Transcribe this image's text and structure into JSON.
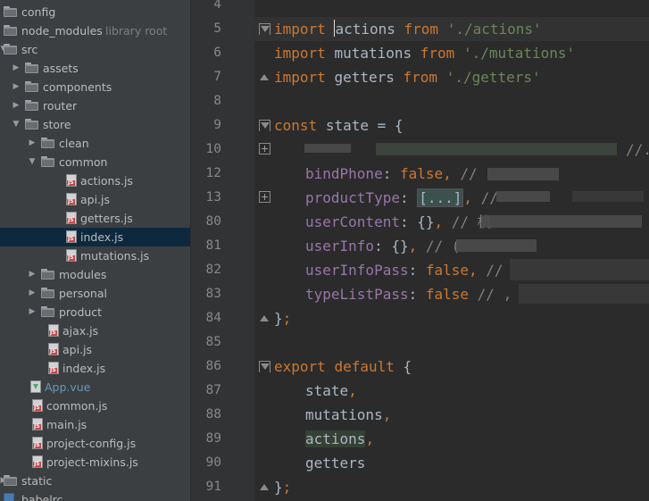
{
  "project_tree": {
    "items": [
      {
        "label": "config",
        "type": "folder",
        "depth": 0,
        "expanded": false,
        "has_arrow": false
      },
      {
        "label": "node_modules",
        "type": "folder",
        "depth": 0,
        "expanded": false,
        "has_arrow": false,
        "hint": "library root"
      },
      {
        "label": "src",
        "type": "folder",
        "depth": 0,
        "expanded": true,
        "has_arrow": true
      },
      {
        "label": "assets",
        "type": "folder",
        "depth": 1,
        "expanded": false,
        "has_arrow": true
      },
      {
        "label": "components",
        "type": "folder",
        "depth": 1,
        "expanded": false,
        "has_arrow": true
      },
      {
        "label": "router",
        "type": "folder",
        "depth": 1,
        "expanded": false,
        "has_arrow": true
      },
      {
        "label": "store",
        "type": "folder",
        "depth": 1,
        "expanded": true,
        "has_arrow": true
      },
      {
        "label": "clean",
        "type": "folder",
        "depth": 2,
        "expanded": false,
        "has_arrow": true
      },
      {
        "label": "common",
        "type": "folder",
        "depth": 2,
        "expanded": true,
        "has_arrow": true
      },
      {
        "label": "actions.js",
        "type": "js",
        "depth": 3
      },
      {
        "label": "api.js",
        "type": "js",
        "depth": 3
      },
      {
        "label": "getters.js",
        "type": "js",
        "depth": 3
      },
      {
        "label": "index.js",
        "type": "js",
        "depth": 3,
        "selected": true
      },
      {
        "label": "mutations.js",
        "type": "js",
        "depth": 3
      },
      {
        "label": "modules",
        "type": "folder",
        "depth": 2,
        "expanded": false,
        "has_arrow": true
      },
      {
        "label": "personal",
        "type": "folder",
        "depth": 2,
        "expanded": false,
        "has_arrow": true
      },
      {
        "label": "product",
        "type": "folder",
        "depth": 2,
        "expanded": false,
        "has_arrow": true
      },
      {
        "label": "ajax.js",
        "type": "js",
        "depth": 2
      },
      {
        "label": "api.js",
        "type": "js",
        "depth": 2
      },
      {
        "label": "index.js",
        "type": "js",
        "depth": 2
      },
      {
        "label": "App.vue",
        "type": "vue",
        "depth": 1
      },
      {
        "label": "common.js",
        "type": "js",
        "depth": 1
      },
      {
        "label": "main.js",
        "type": "js",
        "depth": 1
      },
      {
        "label": "project-config.js",
        "type": "js",
        "depth": 1
      },
      {
        "label": "project-mixins.js",
        "type": "js",
        "depth": 1
      },
      {
        "label": "static",
        "type": "folder",
        "depth": 0,
        "expanded": false,
        "has_arrow": true
      },
      {
        "label": ".babelrc",
        "type": "json",
        "depth": 0
      }
    ]
  },
  "editor": {
    "line_numbers": [
      "4",
      "5",
      "6",
      "7",
      "8",
      "9",
      "10",
      "12",
      "13",
      "80",
      "81",
      "82",
      "83",
      "84",
      "85",
      "86",
      "87",
      "88",
      "89",
      "90",
      "91"
    ],
    "lines": {
      "l5": {
        "kw1": "import",
        "pre_caret": "",
        "post_caret": "actions",
        "kw2": "from",
        "str": "'./actions'"
      },
      "l6": {
        "kw1": "import",
        "name": "mutations",
        "kw2": "from",
        "str": "'./mutations'"
      },
      "l7": {
        "kw1": "import",
        "name": "getters",
        "kw2": "from",
        "str": "'./getters'"
      },
      "l9": {
        "kw": "const",
        "rest": "state = {"
      },
      "l10": {
        "cmt": "//."
      },
      "l12": {
        "prop": "bindPhone",
        "colon": ": ",
        "val": "false",
        "tail": ", ",
        "cmt": "//"
      },
      "l13": {
        "prop": "productType",
        "colon": ": ",
        "collapsed": "[...]",
        "tail": ", ",
        "cmt": "//"
      },
      "l80": {
        "prop": "userContent",
        "colon": ": ",
        "val": "{}",
        "tail": ", ",
        "cmt": "// 杭"
      },
      "l81": {
        "prop": "userInfo",
        "colon": ": ",
        "val": "{}",
        "tail": ", ",
        "cmt": "// ("
      },
      "l82": {
        "prop": "userInfoPass",
        "colon": ": ",
        "val": "false",
        "tail": ", ",
        "cmt": "//"
      },
      "l83": {
        "prop": "typeListPass",
        "colon": ": ",
        "val": "false",
        "tail": " ",
        "cmt": "// ,"
      },
      "l84": {
        "text": "}",
        "semi": ";"
      },
      "l86": {
        "kw1": "export",
        "kw2": "default",
        "rest": " {"
      },
      "l87": {
        "name": "state",
        "tail": ","
      },
      "l88": {
        "name": "mutations",
        "tail": ","
      },
      "l89": {
        "name": "actions",
        "tail": ","
      },
      "l90": {
        "name": "getters"
      },
      "l91": {
        "text": "}",
        "semi": ";"
      }
    }
  }
}
